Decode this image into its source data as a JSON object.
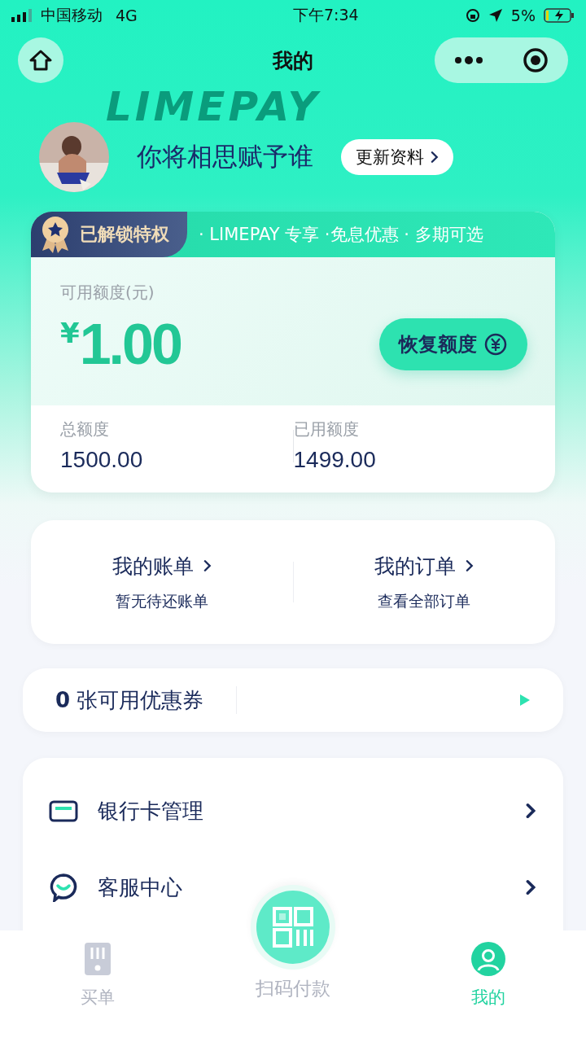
{
  "status_bar": {
    "carrier": "中国移动",
    "network": "4G",
    "time": "下午7:34",
    "battery_text": "5%"
  },
  "nav": {
    "title": "我的"
  },
  "banner": {
    "backdrop_text": "LIMEPAY"
  },
  "profile": {
    "name": "你将相思赋予谁",
    "edit_button": "更新资料"
  },
  "credit_card": {
    "badge": "已解锁特权",
    "perks": "· LIMEPAY 专享 ·免息优惠 · 多期可选",
    "available_label": "可用额度(元)",
    "currency": "¥",
    "available": "1.00",
    "restore_button": "恢复额度",
    "stats": [
      {
        "label": "总额度",
        "value": "1500.00"
      },
      {
        "label": "已用额度",
        "value": "1499.00"
      }
    ]
  },
  "shortcuts": [
    {
      "title": "我的账单",
      "subtitle": "暂无待还账单"
    },
    {
      "title": "我的订单",
      "subtitle": "查看全部订单"
    }
  ],
  "coupon": {
    "count": "0",
    "label": "张可用优惠券"
  },
  "menu": [
    {
      "kind": "card",
      "label": "银行卡管理"
    },
    {
      "kind": "service",
      "label": "客服中心"
    }
  ],
  "tab_bar": [
    {
      "kind": "bill",
      "label": "买单",
      "selected": false
    },
    {
      "kind": "scan",
      "label": "扫码付款",
      "selected": false
    },
    {
      "kind": "me",
      "label": "我的",
      "selected": true
    }
  ]
}
